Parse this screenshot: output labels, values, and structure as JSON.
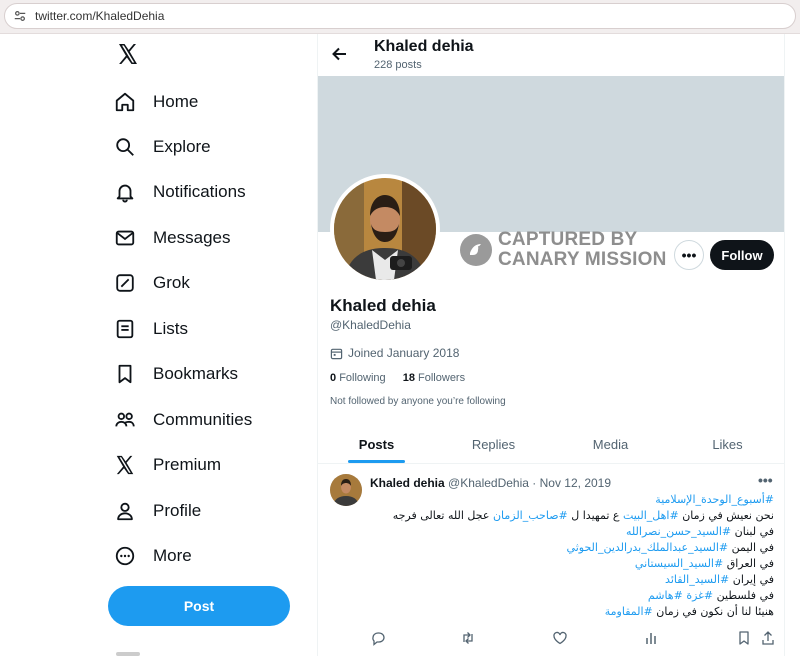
{
  "browser": {
    "url": "twitter.com/KhaledDehia"
  },
  "sidebar": {
    "items": [
      {
        "label": "Home",
        "icon": "home-icon"
      },
      {
        "label": "Explore",
        "icon": "search-icon"
      },
      {
        "label": "Notifications",
        "icon": "bell-icon"
      },
      {
        "label": "Messages",
        "icon": "envelope-icon"
      },
      {
        "label": "Grok",
        "icon": "grok-icon"
      },
      {
        "label": "Lists",
        "icon": "list-icon"
      },
      {
        "label": "Bookmarks",
        "icon": "bookmark-icon"
      },
      {
        "label": "Communities",
        "icon": "people-icon"
      },
      {
        "label": "Premium",
        "icon": "x-icon"
      },
      {
        "label": "Profile",
        "icon": "person-icon"
      },
      {
        "label": "More",
        "icon": "more-circle-icon"
      }
    ],
    "post_label": "Post"
  },
  "header": {
    "name": "Khaled dehia",
    "posts_count": "228 posts"
  },
  "watermark": {
    "line1": "CAPTURED BY",
    "line2": "CANARY MISSION"
  },
  "profile": {
    "name": "Khaled dehia",
    "handle": "@KhaledDehia",
    "joined": "Joined January 2018",
    "following_count": "0",
    "following_label": "Following",
    "followers_count": "18",
    "followers_label": "Followers",
    "not_followed": "Not followed by anyone you’re following",
    "more_label": "•••",
    "follow_label": "Follow"
  },
  "tabs": [
    "Posts",
    "Replies",
    "Media",
    "Likes"
  ],
  "tweet": {
    "author": "Khaled dehia",
    "handle": "@KhaledDehia",
    "separator": "·",
    "date": "Nov 12, 2019",
    "more": "•••",
    "lines": [
      [
        {
          "t": "#أسبوع_الوحدة_الإسلامية",
          "tag": true
        }
      ],
      [
        {
          "t": "نحن نعيش في زمان ",
          "tag": false
        },
        {
          "t": "#اهل_البيت",
          "tag": true
        },
        {
          "t": " ع تمهيدا ل ",
          "tag": false
        },
        {
          "t": "#صاحب_الزمان",
          "tag": true
        },
        {
          "t": " عجل الله تعالى فرجه",
          "tag": false
        }
      ],
      [
        {
          "t": "في لبنان ",
          "tag": false
        },
        {
          "t": "#السيد_حسن_نصرالله",
          "tag": true
        }
      ],
      [
        {
          "t": "في اليمن ",
          "tag": false
        },
        {
          "t": "#السيد_عبدالملك_بدرالدين_الحوثي",
          "tag": true
        }
      ],
      [
        {
          "t": "في العراق ",
          "tag": false
        },
        {
          "t": "#السيد_السيستاني",
          "tag": true
        }
      ],
      [
        {
          "t": "في إيران ",
          "tag": false
        },
        {
          "t": "#السيد_القائد",
          "tag": true
        }
      ],
      [
        {
          "t": "في فلسطين ",
          "tag": false
        },
        {
          "t": "#غزة",
          "tag": true
        },
        {
          "t": " ",
          "tag": false
        },
        {
          "t": "#هاشم",
          "tag": true
        }
      ],
      [
        {
          "t": "هنيئا لنا أن نكون في زمان ",
          "tag": false
        },
        {
          "t": "#المقاومة",
          "tag": true
        }
      ]
    ]
  },
  "colors": {
    "accent": "#1d9bf0",
    "text": "#0f1419",
    "muted": "#536471",
    "banner": "#cfd9de"
  }
}
